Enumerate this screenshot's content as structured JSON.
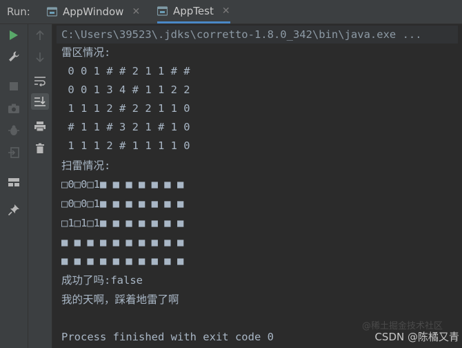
{
  "run": {
    "label": "Run:",
    "tabs": [
      {
        "label": "AppWindow",
        "active": false
      },
      {
        "label": "AppTest",
        "active": true
      }
    ]
  },
  "console": {
    "command": "C:\\Users\\39523\\.jdks\\corretto-1.8.0_342\\bin\\java.exe ...",
    "lines": [
      "雷区情况:",
      " 0 0 1 # # 2 1 1 # #",
      " 0 0 1 3 4 # 1 1 2 2",
      " 1 1 1 2 # 2 2 1 1 0",
      " # 1 1 # 3 2 1 # 1 0",
      " 1 1 1 2 # 1 1 1 1 0",
      "扫雷情况:",
      "□0□0□1■ ■ ■ ■ ■ ■ ■",
      "□0□0□1■ ■ ■ ■ ■ ■ ■",
      "□1□1□1■ ■ ■ ■ ■ ■ ■",
      "■ ■ ■ ■ ■ ■ ■ ■ ■ ■",
      "■ ■ ■ ■ ■ ■ ■ ■ ■ ■",
      "成功了吗:false",
      "我的天啊，踩着地雷了啊",
      "",
      "Process finished with exit code 0"
    ]
  },
  "watermark": "CSDN @陈橘又青",
  "watermark_faint": "@稀土掘金技术社区",
  "colors": {
    "run_icon": "#59a869",
    "text": "#a9b7c6",
    "panel": "#3c3f41",
    "background": "#2b2b2b"
  }
}
